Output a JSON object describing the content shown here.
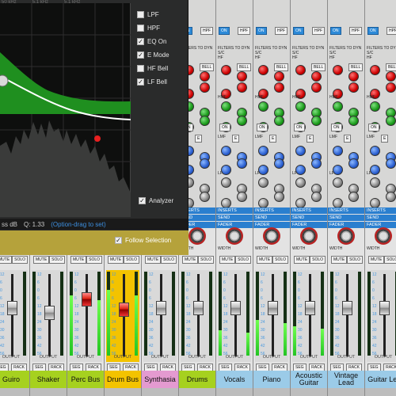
{
  "eq": {
    "top_freqs": [
      "50 kHz",
      "5.1 kHz",
      "5.1 kHz"
    ],
    "options": [
      {
        "label": "LPF",
        "checked": false
      },
      {
        "label": "HPF",
        "checked": false
      },
      {
        "label": "EQ On",
        "checked": true
      },
      {
        "label": "E Mode",
        "checked": true
      },
      {
        "label": "HF Bell",
        "checked": false
      },
      {
        "label": "LF Bell",
        "checked": true
      }
    ],
    "analyzer": {
      "label": "Analyzer",
      "checked": true
    },
    "readout": {
      "gain": "ss dB",
      "q": "Q: 1.33",
      "hint": "(Option-drag to set)"
    },
    "follow_selection": {
      "label": "Follow Selection",
      "checked": true
    },
    "colors": {
      "curve_fill": "#1f8f1f",
      "curve_line": "#ffffff",
      "handle": "#e82020",
      "footer": "#b5a23b"
    }
  },
  "mixer": {
    "labels": {
      "hpf": "HPF",
      "hpf_on": "ON",
      "filters": "FILTERS TO DYN S/C",
      "bell": "BELL",
      "inserts": "INSERTS",
      "send": "SEND",
      "fader": "FADER",
      "width": "WIDTH",
      "mute": "MUTE",
      "solo": "SOLO",
      "output": "OUTPUT",
      "seg": "SEG",
      "rack": "RACK",
      "hf": "HF",
      "hmf": "HMF",
      "lmf": "LMF",
      "lf": "LF",
      "db": "dB",
      "khz": "kHz",
      "hz": "Hz",
      "q": "Q",
      "on": "ON",
      "e": "E"
    },
    "scale": [
      "12",
      "6",
      "0",
      "6",
      "12",
      "18",
      "24",
      "30",
      "36",
      "42",
      "56"
    ],
    "channels": [
      {
        "name": "Guiro",
        "color": "#a6d11f",
        "level": 0.0,
        "fader": 0.62
      },
      {
        "name": "Shaker",
        "color": "#a6d11f",
        "level": 0.0,
        "fader": 0.56
      },
      {
        "name": "Perc Bus",
        "color": "#a6d11f",
        "level": 0.72,
        "fader": 0.75
      },
      {
        "name": "Drum Bus",
        "color": "#f3c300",
        "level": 0.78,
        "fader": 0.6
      },
      {
        "name": "Synthasia",
        "color": "#e49ad0",
        "level": 0.0,
        "fader": 0.62
      },
      {
        "name": "Drums",
        "color": "#a6d11f",
        "level": 0.0,
        "fader": 0.62
      },
      {
        "name": "Vocals",
        "color": "#9bcbe8",
        "level": 0.3,
        "fader": 0.62
      },
      {
        "name": "Piano",
        "color": "#9bcbe8",
        "level": 0.42,
        "fader": 0.62
      },
      {
        "name": "Acoustic Guitar",
        "color": "#9bcbe8",
        "level": 0.35,
        "fader": 0.62
      },
      {
        "name": "Vintage Lead",
        "color": "#9bcbe8",
        "level": 0.0,
        "fader": 0.62
      },
      {
        "name": "Guitar Lef",
        "color": "#9bcbe8",
        "level": 0.0,
        "fader": 0.62
      }
    ]
  }
}
